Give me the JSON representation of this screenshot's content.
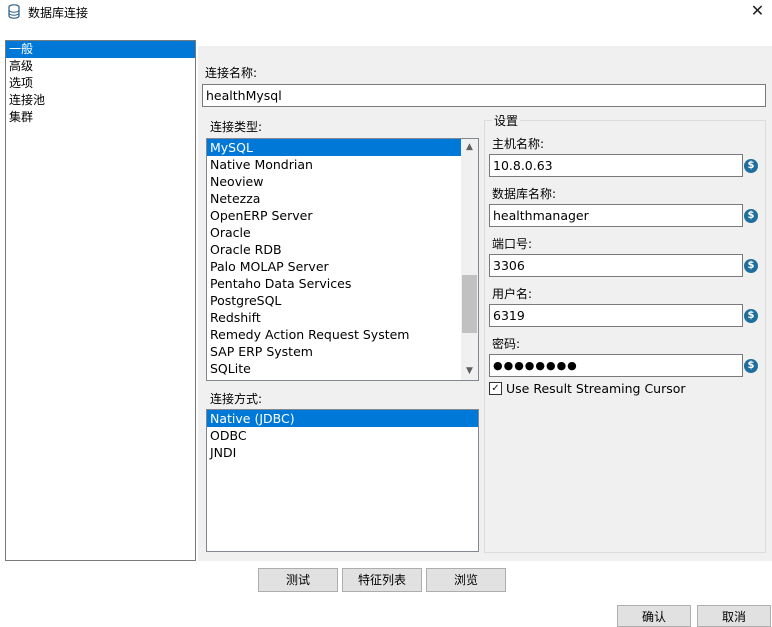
{
  "window": {
    "title": "数据库连接",
    "close_glyph": "✕"
  },
  "nav": {
    "items": [
      "一般",
      "高级",
      "选项",
      "连接池",
      "集群"
    ],
    "selected_index": 0
  },
  "connection_name": {
    "label": "连接名称:",
    "value": "healthMysql"
  },
  "connection_type": {
    "label": "连接类型:",
    "items": [
      "MySQL",
      "Native Mondrian",
      "Neoview",
      "Netezza",
      "OpenERP Server",
      "Oracle",
      "Oracle RDB",
      "Palo MOLAP Server",
      "Pentaho Data Services",
      "PostgreSQL",
      "Redshift",
      "Remedy Action Request System",
      "SAP ERP System",
      "SQLite"
    ],
    "selected": "MySQL"
  },
  "access": {
    "label": "连接方式:",
    "items": [
      "Native (JDBC)",
      "ODBC",
      "JNDI"
    ],
    "selected": "Native (JDBC)"
  },
  "settings": {
    "title": "设置",
    "host": {
      "label": "主机名称:",
      "value": "10.8.0.63"
    },
    "database": {
      "label": "数据库名称:",
      "value": "healthmanager"
    },
    "port": {
      "label": "端口号:",
      "value": "3306"
    },
    "username": {
      "label": "用户名:",
      "value": "6319"
    },
    "password": {
      "label": "密码:",
      "value": "●●●●●●●●"
    },
    "streaming_cursor": {
      "label": "Use Result Streaming Cursor",
      "checked": true
    }
  },
  "buttons": {
    "test": "测试",
    "feature_list": "特征列表",
    "browse": "浏览",
    "ok": "确认",
    "cancel": "取消"
  },
  "icons": {
    "variable": "$",
    "scroll_up": "▲",
    "scroll_down": "▼",
    "check": "✓"
  },
  "colors": {
    "selection": "#0078d7",
    "panel_bg": "#f0f0f0",
    "variable_icon": "#1f6f9c"
  }
}
